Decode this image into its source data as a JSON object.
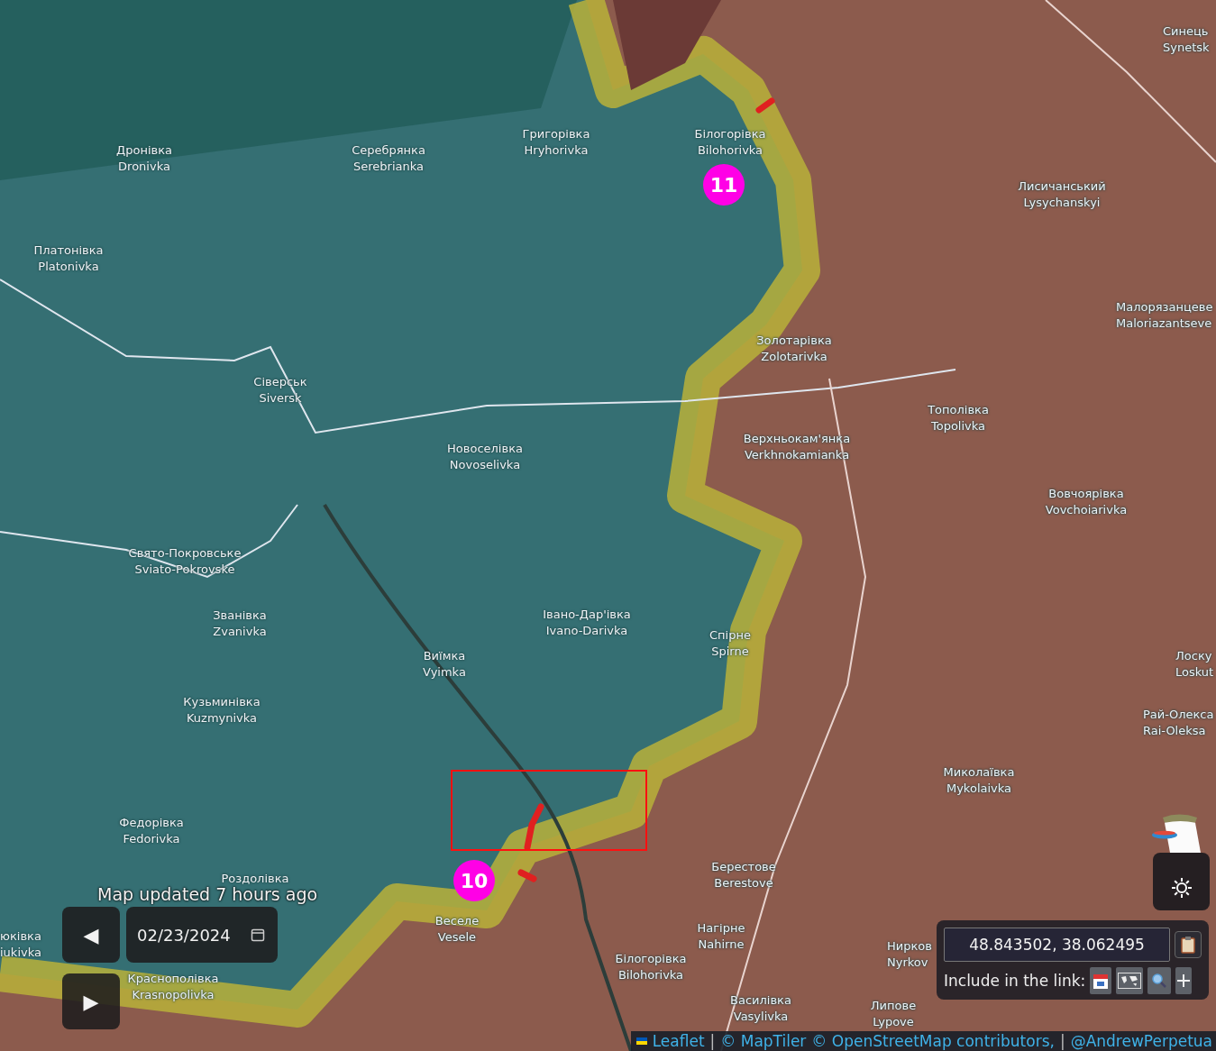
{
  "map": {
    "places": [
      {
        "name_uk": "Дронівка",
        "name_en": "Dronivka"
      },
      {
        "name_uk": "Серебрянка",
        "name_en": "Serebrianka"
      },
      {
        "name_uk": "Григорівка",
        "name_en": "Hryhorivka"
      },
      {
        "name_uk": "Білогорівка",
        "name_en": "Bilohorivka"
      },
      {
        "name_uk": "Синець",
        "name_en": "Synetsk"
      },
      {
        "name_uk": "Лисичанський",
        "name_en": "Lysychanskyi"
      },
      {
        "name_uk": "Платонівка",
        "name_en": "Platonivka"
      },
      {
        "name_uk": "Малорязанцеве",
        "name_en": "Maloriazantseve"
      },
      {
        "name_uk": "Золотарівка",
        "name_en": "Zolotarivka"
      },
      {
        "name_uk": "Сіверськ",
        "name_en": "Siversk"
      },
      {
        "name_uk": "Тополівка",
        "name_en": "Topolivka"
      },
      {
        "name_uk": "Верхньокам'янка",
        "name_en": "Verkhnokamianka"
      },
      {
        "name_uk": "Новоселівка",
        "name_en": "Novoselivka"
      },
      {
        "name_uk": "Вовчоярівка",
        "name_en": "Vovchoiarivka"
      },
      {
        "name_uk": "Свято-Покровське",
        "name_en": "Sviato-Pokrovske"
      },
      {
        "name_uk": "Званівка",
        "name_en": "Zvanivka"
      },
      {
        "name_uk": "Івано-Дар'івка",
        "name_en": "Ivano-Darivka"
      },
      {
        "name_uk": "Спірне",
        "name_en": "Spirne"
      },
      {
        "name_uk": "Виїмка",
        "name_en": "Vyimka"
      },
      {
        "name_uk": "Лоску",
        "name_en": "Loskut"
      },
      {
        "name_uk": "Кузьминівка",
        "name_en": "Kuzmynivka"
      },
      {
        "name_uk": "Рай-Олекса",
        "name_en": "Rai-Oleksa"
      },
      {
        "name_uk": "Миколаївка",
        "name_en": "Mykolaivka"
      },
      {
        "name_uk": "Федорівка",
        "name_en": "Fedorivka"
      },
      {
        "name_uk": "Роздолівка"
      },
      {
        "name_uk": "Берестове",
        "name_en": "Berestove"
      },
      {
        "name_uk": "Веселе",
        "name_en": "Vesele"
      },
      {
        "name_uk": "Нагірне",
        "name_en": "Nahirne"
      },
      {
        "name_uk": "Нирков",
        "name_en": "Nyrkov"
      },
      {
        "name_uk": "юківка",
        "name_en": "iukivka"
      },
      {
        "name_uk": "Білогорівка",
        "name_en": "Bilohorivka"
      },
      {
        "name_uk": "Краснополівка",
        "name_en": "Krasnopolivka"
      },
      {
        "name_uk": "Василівка",
        "name_en": "Vasylivka"
      },
      {
        "name_uk": "Липове",
        "name_en": "Lypove"
      }
    ],
    "markers": [
      "11",
      "10"
    ]
  },
  "update_note": "Map updated 7 hours ago",
  "date_controls": {
    "prev": "◀",
    "date": "02/23/2024",
    "play": "▶"
  },
  "coordinates": {
    "value": "48.843502, 38.062495",
    "include_label": "Include in the link:"
  },
  "attribution": {
    "leaflet": "Leaflet",
    "separator": "|",
    "maptiler": "© MapTiler",
    "osm": "© OpenStreetMap contributors,",
    "separator_2": "|",
    "author": "@AndrewPerpetua"
  }
}
